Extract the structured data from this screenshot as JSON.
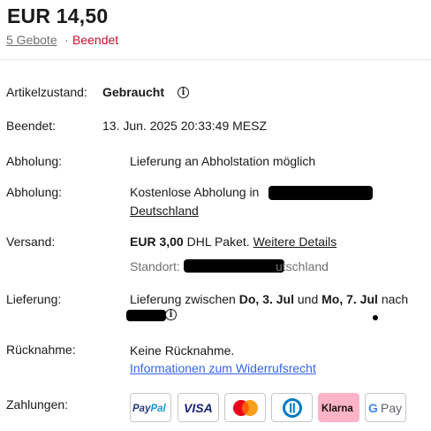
{
  "header": {
    "price": "EUR 14,50",
    "bids": "5 Gebote",
    "separator": "·",
    "status": "Beendet"
  },
  "condition": {
    "label": "Artikelzustand:",
    "value": "Gebraucht"
  },
  "ended": {
    "label": "Beendet:",
    "value": "13. Jun. 2025 20:33:49 MESZ"
  },
  "pickup1": {
    "label": "Abholung:",
    "value": "Lieferung an Abholstation möglich"
  },
  "pickup2": {
    "label": "Abholung:",
    "value_prefix": "Kostenlose Abholung in",
    "country": "Deutschland"
  },
  "shipping": {
    "label": "Versand:",
    "cost": "EUR 3,00",
    "method": "DHL Paket.",
    "details_link": "Weitere Details",
    "location_label": "Standort:",
    "location_suffix": "utschland"
  },
  "delivery": {
    "label": "Lieferung:",
    "prefix": "Lieferung zwischen",
    "date_from": "Do, 3. Jul",
    "connector": "und",
    "date_to": "Mo, 7. Jul",
    "suffix": "nach"
  },
  "returns": {
    "label": "Rücknahme:",
    "value": "Keine Rücknahme.",
    "link": "Informationen zum Widerrufsrecht"
  },
  "payments": {
    "label": "Zahlungen:",
    "methods": [
      "PayPal",
      "VISA",
      "Mastercard",
      "Diners Club",
      "Klarna",
      "G Pay"
    ],
    "colors": {
      "paypal_dark": "#253b80",
      "paypal_light": "#179bd7",
      "visa": "#1a1f71",
      "mc_red": "#eb001b",
      "mc_orange": "#f79e1b",
      "mc_yellow": "#ff5f00",
      "diners": "#0079be",
      "klarna_bg": "#ffb3c7"
    }
  }
}
